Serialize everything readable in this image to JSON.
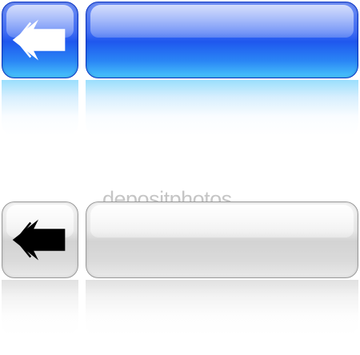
{
  "watermark": {
    "text": "depositphotos"
  },
  "colors": {
    "blue_accent": "#1f57ee",
    "blue_light": "#48c4fb",
    "grey_base": "#d3d3d3",
    "arrow_white": "#ffffff",
    "arrow_black": "#000000",
    "background": "#ffffff"
  },
  "buttons": {
    "blue_back": {
      "icon": "left-arrow-icon"
    },
    "blue_bar": {
      "label": ""
    },
    "grey_back": {
      "icon": "left-arrow-icon"
    },
    "grey_bar": {
      "label": ""
    }
  }
}
